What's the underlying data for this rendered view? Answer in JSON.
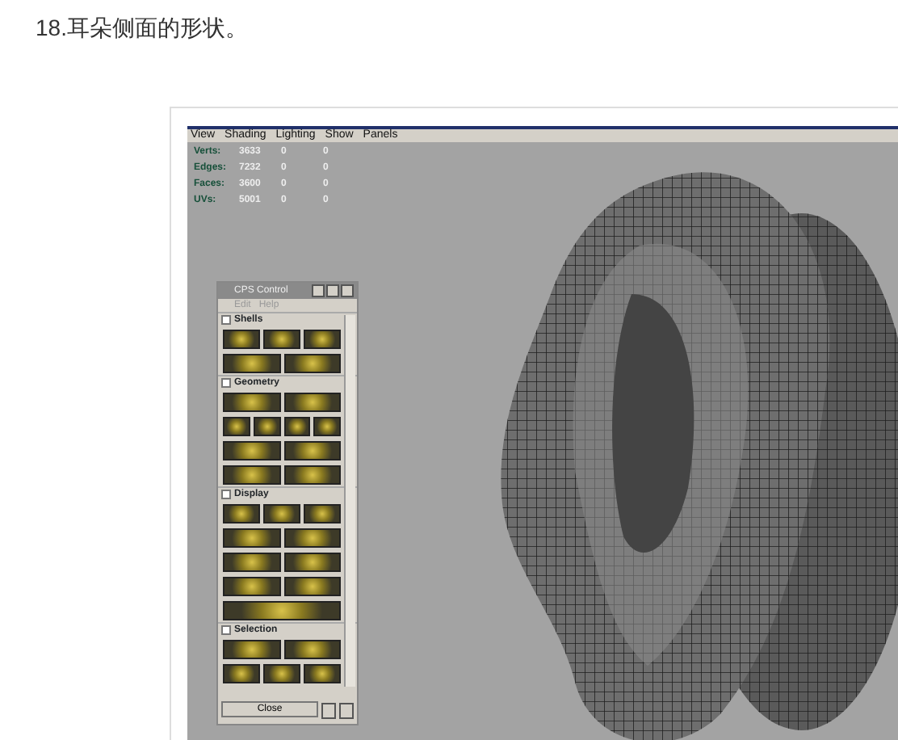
{
  "heading": "18.耳朵侧面的形状。",
  "viewport": {
    "menu": [
      "View",
      "Shading",
      "Lighting",
      "Show",
      "Panels"
    ],
    "stats": [
      {
        "label": "Verts:",
        "values": [
          "3633",
          "0",
          "0"
        ]
      },
      {
        "label": "Edges:",
        "values": [
          "7232",
          "0",
          "0"
        ]
      },
      {
        "label": "Faces:",
        "values": [
          "3600",
          "0",
          "0"
        ]
      },
      {
        "label": "UVs:",
        "values": [
          "5001",
          "0",
          "0"
        ]
      }
    ]
  },
  "panel": {
    "title": "CPS Control",
    "menu": [
      "Edit",
      "Help"
    ],
    "sections": [
      {
        "label": "Shells",
        "expanded": true
      },
      {
        "label": "Geometry",
        "expanded": true
      },
      {
        "label": "Display",
        "expanded": true
      },
      {
        "label": "Selection",
        "expanded": true
      }
    ],
    "close": "Close"
  }
}
